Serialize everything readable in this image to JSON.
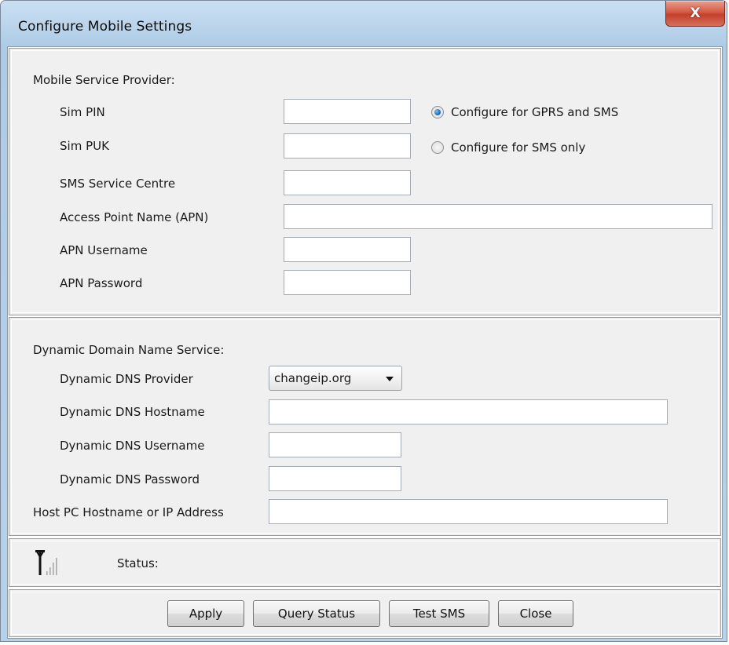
{
  "window": {
    "title": "Configure Mobile Settings",
    "close_label": "X"
  },
  "mobile": {
    "section_label": "Mobile Service Provider:",
    "fields": {
      "sim_pin": {
        "label": "Sim PIN",
        "value": ""
      },
      "sim_puk": {
        "label": "Sim PUK",
        "value": ""
      },
      "sms_centre": {
        "label": "SMS Service Centre",
        "value": ""
      },
      "apn": {
        "label": "Access Point Name (APN)",
        "value": ""
      },
      "apn_user": {
        "label": "APN Username",
        "value": ""
      },
      "apn_pass": {
        "label": "APN Password",
        "value": ""
      }
    },
    "radios": [
      {
        "label": "Configure for GPRS and SMS",
        "selected": true
      },
      {
        "label": "Configure for SMS only",
        "selected": false
      }
    ]
  },
  "ddns": {
    "section_label": "Dynamic Domain Name Service:",
    "provider": {
      "label": "Dynamic DNS Provider",
      "value": "changeip.org"
    },
    "hostname": {
      "label": "Dynamic DNS Hostname",
      "value": ""
    },
    "username": {
      "label": "Dynamic DNS Username",
      "value": ""
    },
    "password": {
      "label": "Dynamic DNS Password",
      "value": ""
    },
    "host_pc": {
      "label": "Host PC Hostname or IP Address",
      "value": ""
    }
  },
  "status": {
    "icon": "signal-antenna-icon",
    "label": "Status:",
    "value": ""
  },
  "buttons": {
    "apply": "Apply",
    "query_status": "Query Status",
    "test_sms": "Test SMS",
    "close": "Close"
  }
}
